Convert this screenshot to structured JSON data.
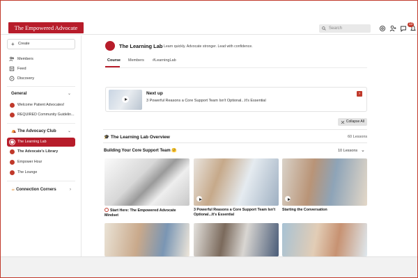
{
  "brand": {
    "logo_text": "The Empowered Advocate",
    "accent": "#b71c2a"
  },
  "header": {
    "search_placeholder": "Search",
    "notification_count": "13"
  },
  "sidebar": {
    "create_label": "Create",
    "nav": [
      {
        "label": "Members",
        "icon": "members-icon"
      },
      {
        "label": "Feed",
        "icon": "feed-icon"
      },
      {
        "label": "Discovery",
        "icon": "compass-icon"
      }
    ],
    "general": {
      "title": "General",
      "items": [
        {
          "label": "Welcome Patient Advocates!"
        },
        {
          "label": "REQUIRED Community Guidelin..."
        }
      ]
    },
    "club": {
      "title": "The Advocacy Club",
      "items": [
        {
          "label": "The Learning Lab",
          "active": true
        },
        {
          "label": "The Advocate's Library",
          "active": false
        },
        {
          "label": "Empower Hour",
          "active": false
        },
        {
          "label": "The Lounge",
          "active": false
        }
      ]
    },
    "corners": {
      "title": "Connection Corners"
    }
  },
  "main": {
    "title": "The Learning Lab",
    "tagline": "Learn quickly. Advocate stronger. Lead with confidence.",
    "tabs": [
      {
        "label": "Course",
        "active": true
      },
      {
        "label": "Members",
        "active": false
      },
      {
        "label": "#LearningLab",
        "active": false
      }
    ],
    "next_up": {
      "label": "Next up",
      "title": "3 Powerful Reasons a Core Support Team Isn't Optional...It's Essential"
    },
    "collapse_label": "Collapse All",
    "overview": {
      "title": "The Learning Lab Overview",
      "count": "60 Lessons"
    },
    "section": {
      "title": "Building Your Core Support Team 🤗",
      "count": "10 Lessons"
    },
    "lessons": [
      {
        "title": "Start Here: The Empowered Advocate Mindset",
        "has_status": true
      },
      {
        "title": "3 Powerful Reasons a Core Support Team Isn't Optional...It's Essential",
        "has_status": false
      },
      {
        "title": "Starting the Conversation",
        "has_status": false
      }
    ]
  }
}
